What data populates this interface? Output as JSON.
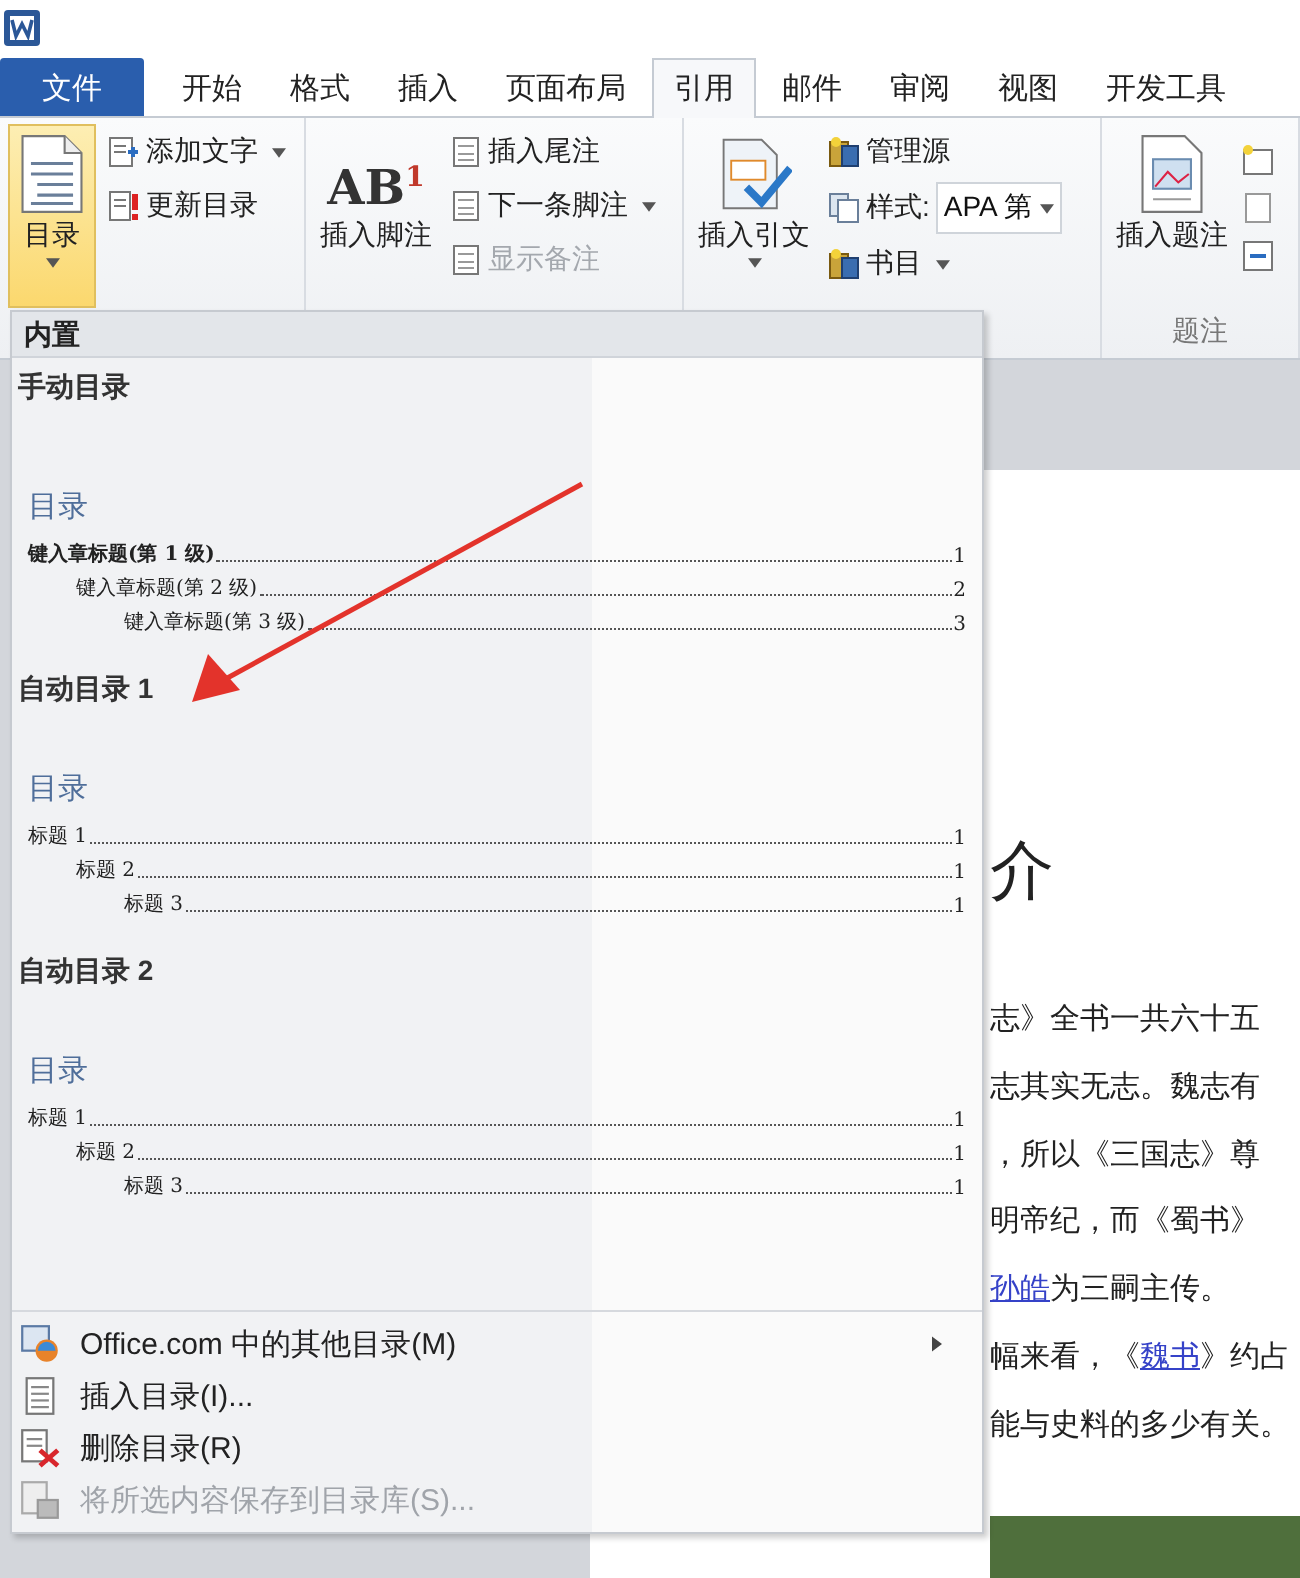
{
  "tabs": [
    {
      "label": "文件",
      "kind": "file",
      "selected": false
    },
    {
      "label": "开始",
      "kind": "tab",
      "selected": false
    },
    {
      "label": "格式",
      "kind": "tab",
      "selected": false
    },
    {
      "label": "插入",
      "kind": "tab",
      "selected": false
    },
    {
      "label": "页面布局",
      "kind": "tab",
      "selected": false
    },
    {
      "label": "引用",
      "kind": "tab",
      "selected": true
    },
    {
      "label": "邮件",
      "kind": "tab",
      "selected": false
    },
    {
      "label": "审阅",
      "kind": "tab",
      "selected": false
    },
    {
      "label": "视图",
      "kind": "tab",
      "selected": false
    },
    {
      "label": "开发工具",
      "kind": "tab",
      "selected": false
    }
  ],
  "ribbon": {
    "groups": [
      {
        "kind": "toc",
        "large": {
          "label": "目录",
          "dropdown": true,
          "pressed": true
        },
        "small": [
          {
            "label": "添加文字",
            "dropdown": true,
            "disabled": false
          },
          {
            "label": "更新目录",
            "dropdown": false,
            "disabled": false
          }
        ]
      },
      {
        "kind": "footnote",
        "large": {
          "label": "插入脚注",
          "icon_text": "AB$^{1}$",
          "dropdown": false,
          "pressed": false
        },
        "small": [
          {
            "label": "插入尾注",
            "dropdown": false,
            "disabled": false
          },
          {
            "label": "下一条脚注",
            "dropdown": true,
            "disabled": false
          },
          {
            "label": "显示备注",
            "dropdown": false,
            "disabled": true
          }
        ]
      },
      {
        "kind": "citation",
        "large": {
          "label": "插入引文",
          "dropdown": true,
          "pressed": false
        },
        "small": [
          {
            "label": "管理源",
            "dropdown": false,
            "disabled": false
          },
          {
            "label": "样式:",
            "value": "APA 第",
            "dropdown": true,
            "disabled": false
          },
          {
            "label": "书目",
            "dropdown": true,
            "disabled": false
          }
        ]
      },
      {
        "kind": "caption",
        "large": {
          "label": "插入题注",
          "dropdown": false,
          "pressed": false
        },
        "label": "题注"
      }
    ]
  },
  "toc_menu": {
    "header": "内置",
    "gallery": [
      {
        "title": "手动目录",
        "heading": "目录",
        "entries": [
          {
            "label": "键入章标题(第 1 级)",
            "page": "1",
            "children": [
              {
                "label": "键入章标题(第 2 级)",
                "page": "2",
                "children": [
                  {
                    "label": "键入章标题(第 3 级)",
                    "page": "3"
                  }
                ]
              }
            ]
          }
        ]
      },
      {
        "title": "自动目录 1",
        "heading": "目录",
        "entries": [
          {
            "label": "标题 1",
            "page": "1",
            "children": [
              {
                "label": "标题 2",
                "page": "1",
                "children": [
                  {
                    "label": "标题 3",
                    "page": "1"
                  }
                ]
              }
            ]
          }
        ]
      },
      {
        "title": "自动目录 2",
        "heading": "目录",
        "entries": [
          {
            "label": "标题 1",
            "page": "1",
            "children": [
              {
                "label": "标题 2",
                "page": "1",
                "children": [
                  {
                    "label": "标题 3",
                    "page": "1"
                  }
                ]
              }
            ]
          }
        ]
      }
    ],
    "items": [
      {
        "label": "Office.com 中的其他目录(M)",
        "kind": "online",
        "submenu": true,
        "disabled": false
      },
      {
        "label": "插入目录(I)...",
        "kind": "insert",
        "submenu": false,
        "disabled": false
      },
      {
        "label": "删除目录(R)",
        "kind": "remove",
        "submenu": false,
        "disabled": false
      },
      {
        "label": "将所选内容保存到目录库(S)...",
        "kind": "save",
        "submenu": false,
        "disabled": true
      }
    ]
  },
  "document": {
    "heading": "介",
    "lines": [
      [
        {
          "text": "志》全书一共六十五",
          "kind": "plain"
        }
      ],
      [
        {
          "text": "志其实无志。魏志有",
          "kind": "plain"
        }
      ],
      [
        {
          "text": "，所以《三国志》尊",
          "kind": "plain"
        }
      ],
      [
        {
          "text": "明帝纪，而《蜀书》",
          "kind": "plain"
        }
      ],
      [
        {
          "text": "孙皓",
          "kind": "link"
        },
        {
          "text": "为三嗣主传。",
          "kind": "plain"
        }
      ],
      [
        {
          "text": "幅来看，《",
          "kind": "plain"
        },
        {
          "text": "魏书",
          "kind": "link"
        },
        {
          "text": "》约占",
          "kind": "plain"
        }
      ],
      [
        {
          "text": "能与史料的多少有关。",
          "kind": "plain"
        }
      ]
    ]
  }
}
